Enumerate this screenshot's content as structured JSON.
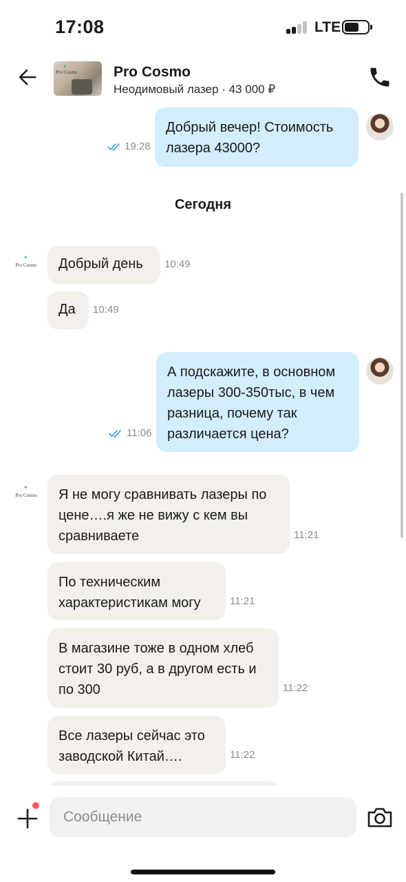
{
  "status_bar": {
    "time": "17:08",
    "network": "LTE"
  },
  "header": {
    "seller_name": "Pro Cosmo",
    "listing": "Неодимовый лазер · 43 000 ₽",
    "thumb_brand": "Pro Cosmo"
  },
  "date_separator": "Сегодня",
  "seller_avatar_text": "Pro Cosmo",
  "messages": [
    {
      "direction": "out",
      "text": "Добрый вечер! Стоимость лазера 43000?",
      "time": "19:28",
      "read": true
    },
    {
      "direction": "in",
      "text": "Добрый день",
      "time": "10:49"
    },
    {
      "direction": "in",
      "text": "Да",
      "time": "10:49"
    },
    {
      "direction": "out",
      "text": "А подскажите, в основном лазеры 300-350тыс, в чем разница, почему так различается цена?",
      "time": "11:06",
      "read": true
    },
    {
      "direction": "in",
      "text": "Я не могу сравнивать лазеры по цене….я же не вижу с кем вы сравниваете",
      "time": "11:21"
    },
    {
      "direction": "in",
      "text": "По техническим характеристикам могу",
      "time": "11:21"
    },
    {
      "direction": "in",
      "text": "В магазине тоже в одном хлеб стоит 30 руб, а в другом есть и по 300",
      "time": "11:22"
    },
    {
      "direction": "in",
      "text": "Все лазеры сейчас это заводской Китай….",
      "time": "11:22"
    }
  ],
  "input": {
    "placeholder": "Сообщение",
    "value": ""
  },
  "colors": {
    "outgoing_bubble": "#d2edfc",
    "incoming_bubble": "#f3f0eb",
    "read_ticks": "#3aa3e3",
    "notification_dot": "#ff5a5f"
  },
  "icons": {
    "back": "arrow-left-icon",
    "call": "phone-icon",
    "attach": "plus-icon",
    "camera": "camera-icon",
    "read_status": "double-check-icon"
  }
}
